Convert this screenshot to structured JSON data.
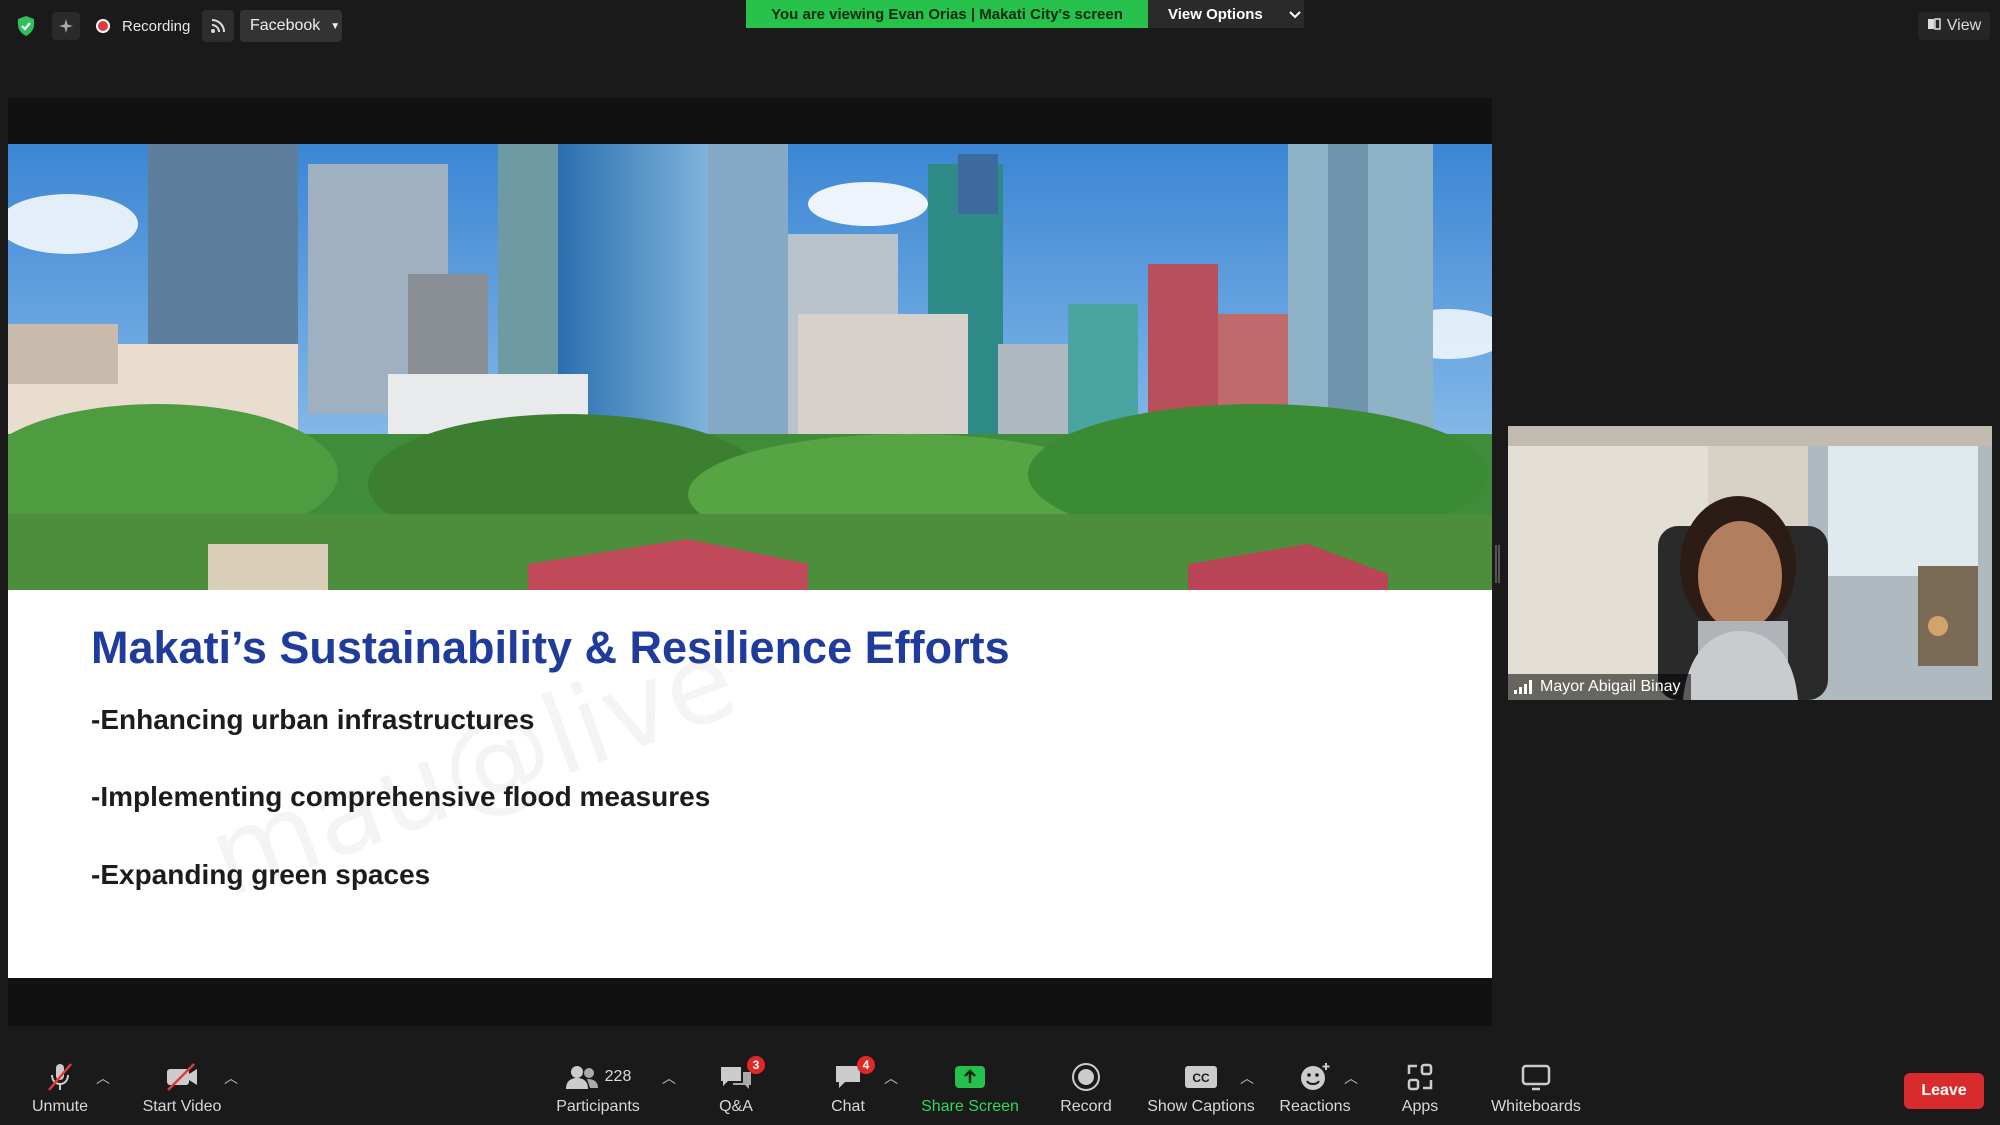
{
  "top_bar": {
    "recording_label": "Recording",
    "stream_target": "Facebook",
    "viewing_banner": "You are viewing Evan Orias | Makati City's screen",
    "view_options_label": "View Options",
    "view_label": "View"
  },
  "shared_screen": {
    "slide_title": "Makati’s Sustainability & Resilience Efforts",
    "bullets": [
      "-Enhancing urban infrastructures",
      "-Implementing comprehensive flood measures",
      "-Expanding green spaces"
    ]
  },
  "participant_video": {
    "name": "Mayor Abigail Binay"
  },
  "toolbar": {
    "unmute": "Unmute",
    "start_video": "Start Video",
    "participants": "Participants",
    "participants_count": "228",
    "qa": "Q&A",
    "qa_badge": "3",
    "chat": "Chat",
    "chat_badge": "4",
    "share_screen": "Share Screen",
    "record": "Record",
    "show_captions": "Show Captions",
    "reactions": "Reactions",
    "apps": "Apps",
    "whiteboards": "Whiteboards",
    "leave": "Leave"
  },
  "colors": {
    "background": "#1a1a1a",
    "banner_green": "#27c24c",
    "slide_title_blue": "#1f3c9c",
    "leave_red": "#d92b2b",
    "share_green": "#2fd65c"
  }
}
